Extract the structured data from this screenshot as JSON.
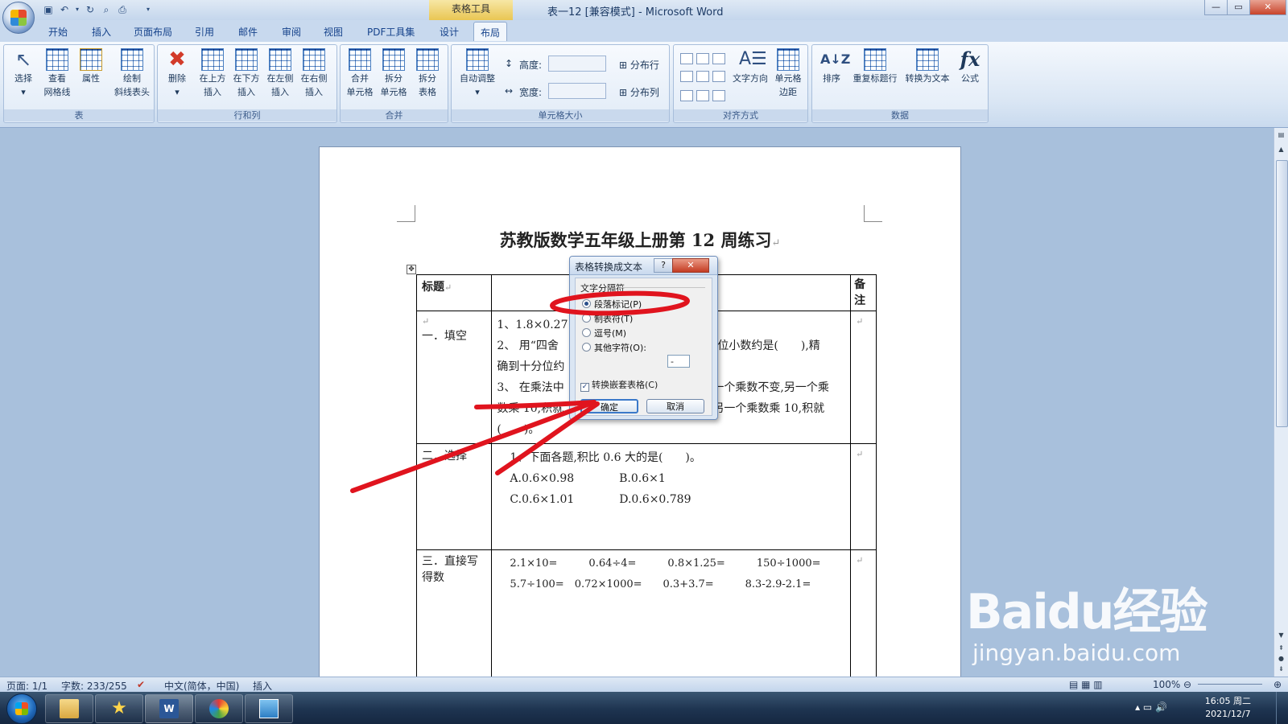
{
  "window": {
    "title": "表一12 [兼容模式] - Microsoft Word",
    "context_tab_title": "表格工具"
  },
  "tabs": [
    "开始",
    "插入",
    "页面布局",
    "引用",
    "邮件",
    "审阅",
    "视图",
    "PDF工具集",
    "设计",
    "布局"
  ],
  "active_tab": "布局",
  "ribbon": {
    "groups": {
      "table": "表",
      "rows_cols": "行和列",
      "merge": "合并",
      "cell_size": "单元格大小",
      "alignment": "对齐方式",
      "data": "数据"
    },
    "table_buttons": [
      {
        "line1": "选择",
        "line2": "▾"
      },
      {
        "line1": "查看",
        "line2": "网格线"
      },
      {
        "line1": "属性",
        "line2": ""
      },
      {
        "line1": "绘制",
        "line2": "斜线表头"
      }
    ],
    "rows_buttons": [
      {
        "line1": "删除",
        "line2": "▾"
      },
      {
        "line1": "在上方",
        "line2": "插入"
      },
      {
        "line1": "在下方",
        "line2": "插入"
      },
      {
        "line1": "在左侧",
        "line2": "插入"
      },
      {
        "line1": "在右侧",
        "line2": "插入"
      }
    ],
    "merge_buttons": [
      {
        "line1": "合并",
        "line2": "单元格"
      },
      {
        "line1": "拆分",
        "line2": "单元格"
      },
      {
        "line1": "拆分",
        "line2": "表格"
      }
    ],
    "cell_size": {
      "autofit_line1": "自动调整",
      "autofit_line2": "▾",
      "height_label": "高度:",
      "width_label": "宽度:",
      "distribute_rows": "分布行",
      "distribute_cols": "分布列"
    },
    "alignment_buttons": [
      {
        "line1": "文字方向",
        "line2": ""
      },
      {
        "line1": "单元格",
        "line2": "边距"
      }
    ],
    "data_buttons": [
      {
        "line1": "排序"
      },
      {
        "line1": "重复标题行"
      },
      {
        "line1": "转换为文本"
      },
      {
        "line1": "公式"
      }
    ]
  },
  "document": {
    "title": "苏教版数学五年级上册第 12 周练习",
    "header_row": {
      "col1": "标题",
      "col3": "备注"
    },
    "rows": [
      {
        "label": "一．填空",
        "lines": [
          "1、1.8×0.27",
          "2、 用“四舍",
          "确到十分位约",
          "3、 在乘法中",
          "数乘 10,积就",
          "(　　)。"
        ],
        "right_fragments": [
          "位小数约是(　　),精",
          "一个乘数不变,另一个乘",
          "另一个乘数乘 10,积就"
        ]
      },
      {
        "label": "二．选择",
        "lines": [
          "1、下面各题,积比 0.6 大的是(　　)。",
          "A.0.6×0.98　　　　B.0.6×1",
          "C.0.6×1.01　　　　D.0.6×0.789"
        ]
      },
      {
        "label": "三．直接写得数",
        "lines": [
          "2.1×10=　　　0.64÷4=　　　0.8×1.25=　　　150÷1000=",
          "5.7÷100=　0.72×1000=　　0.3+3.7=　　　8.3-2.9-2.1="
        ]
      }
    ]
  },
  "dialog": {
    "title": "表格转换成文本",
    "help": "?",
    "group_label": "文字分隔符",
    "options": [
      {
        "label": "段落标记(P)",
        "checked": true
      },
      {
        "label": "制表符(T)",
        "checked": false
      },
      {
        "label": "逗号(M)",
        "checked": false
      },
      {
        "label": "其他字符(O):",
        "checked": false
      }
    ],
    "other_char_value": "-",
    "nested_checkbox": {
      "label": "转换嵌套表格(C)",
      "checked": true
    },
    "ok": "确定",
    "cancel": "取消"
  },
  "statusbar": {
    "page": "页面: 1/1",
    "words": "字数: 233/255",
    "language": "中文(简体，中国)",
    "mode": "插入",
    "zoom": "100%"
  },
  "taskbar": {
    "time": "16:05 周二",
    "date": "2021/12/7"
  },
  "watermark": {
    "main": "Baidu经验",
    "sub": "jingyan.baidu.com"
  },
  "colors": {
    "annotation_red": "#e0141e",
    "ribbon_text": "#15428b"
  }
}
